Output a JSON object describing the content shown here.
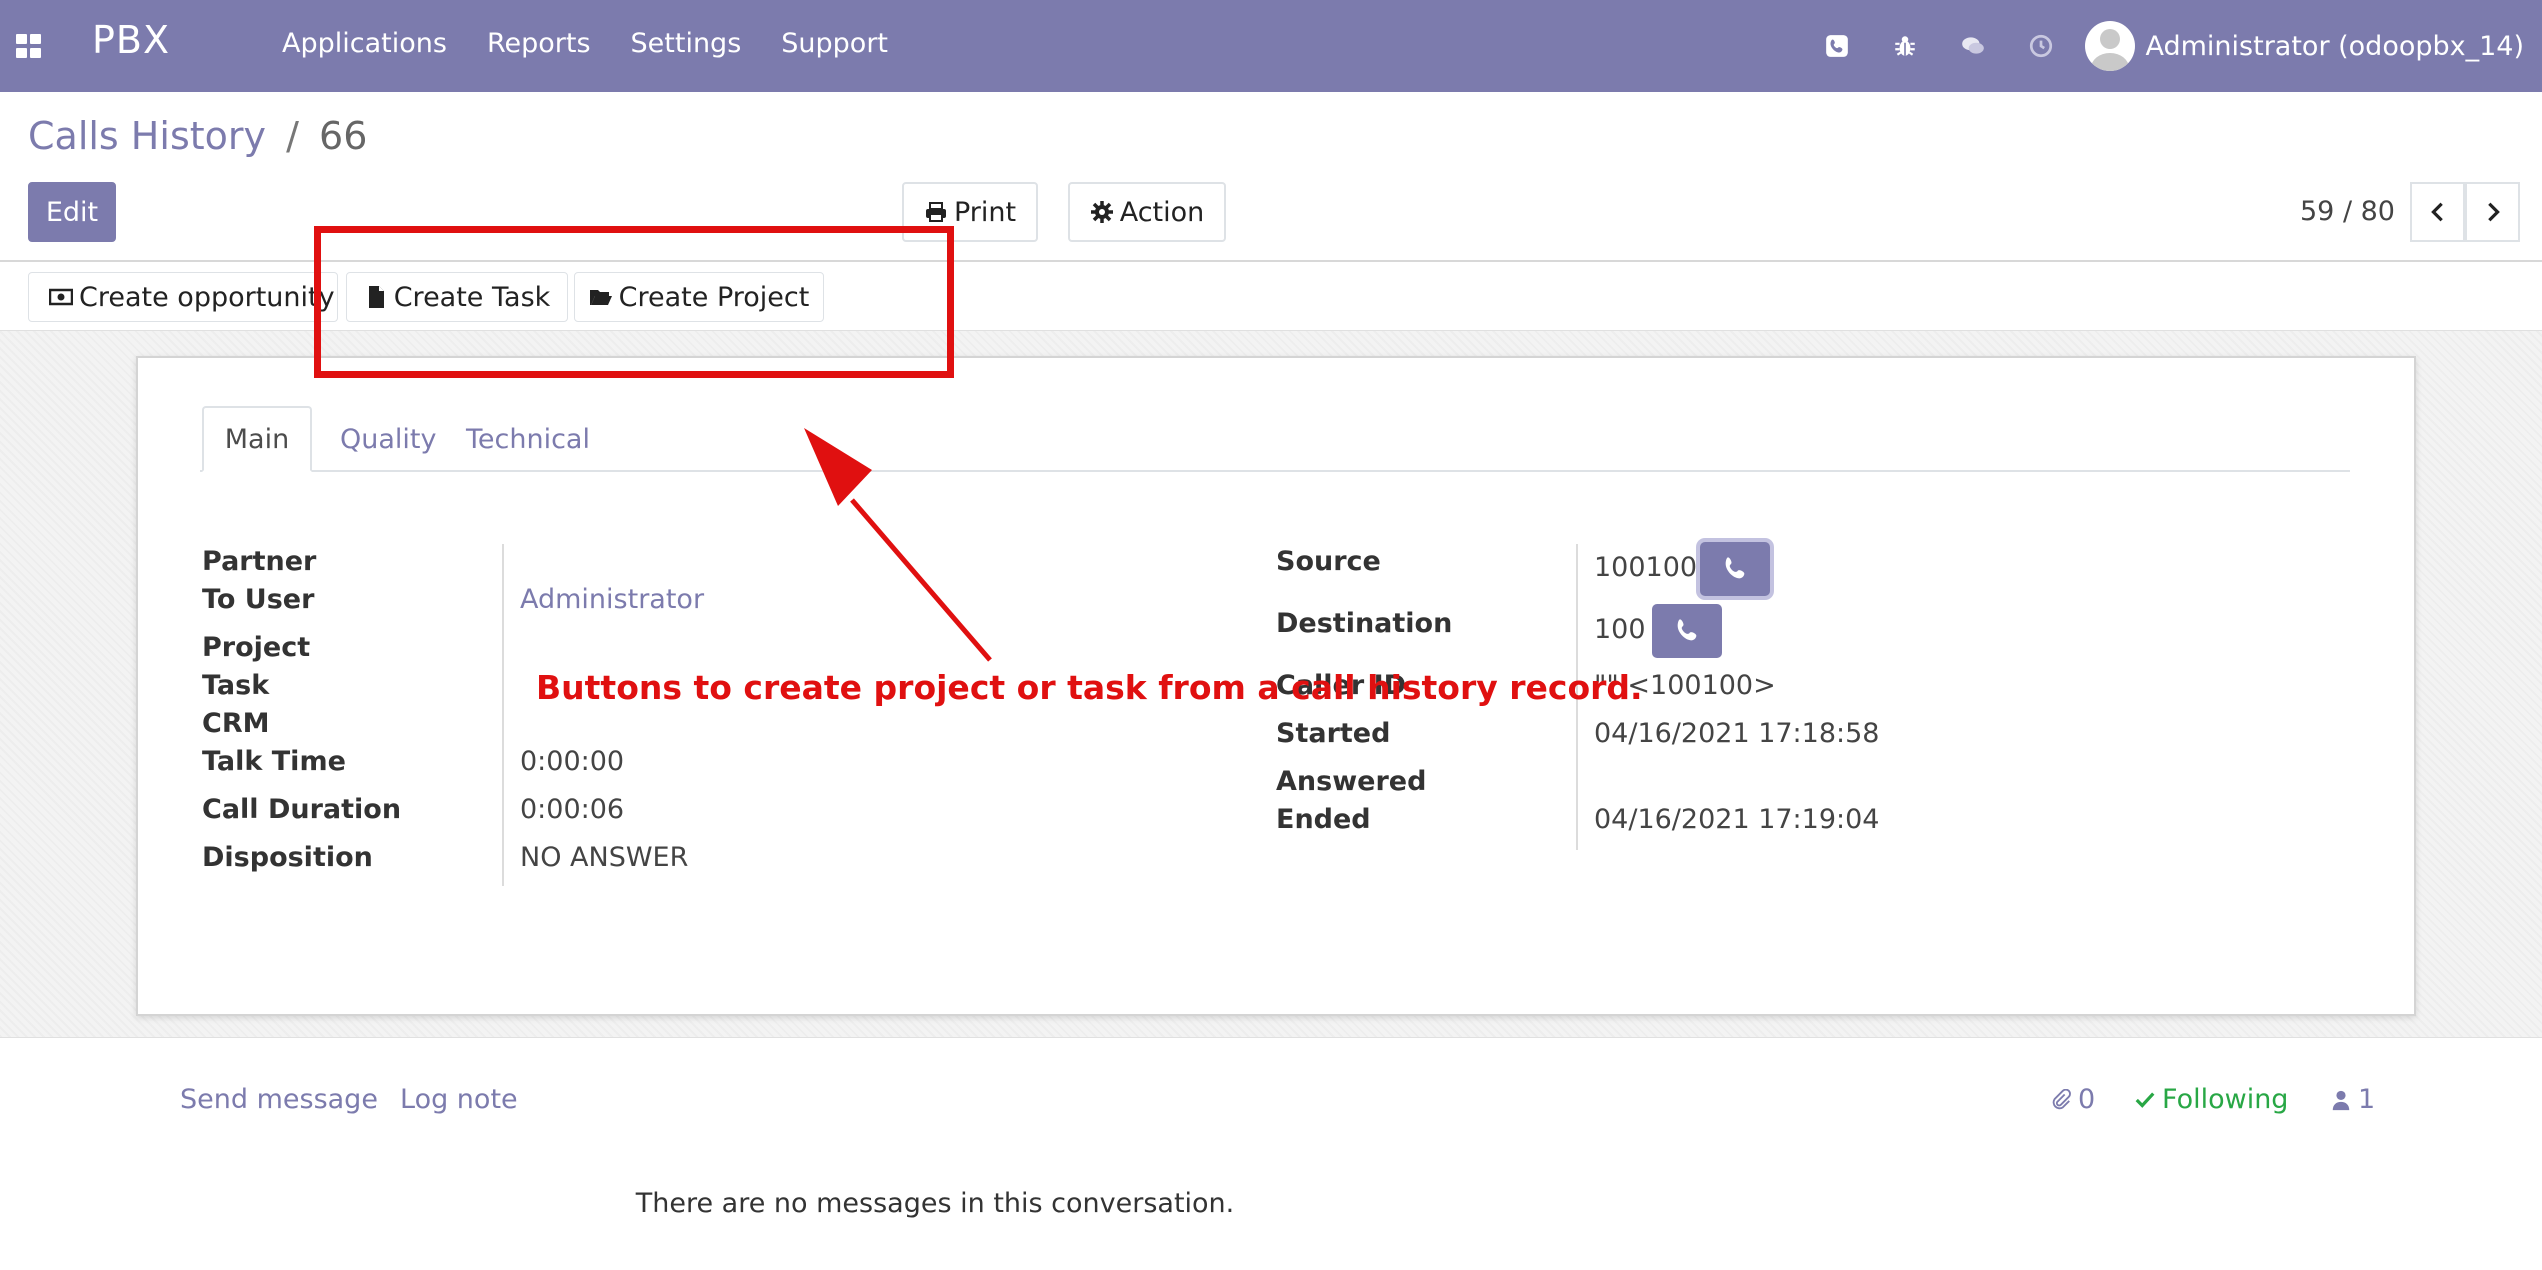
{
  "navbar": {
    "brand": "PBX",
    "menu": [
      "Applications",
      "Reports",
      "Settings",
      "Support"
    ],
    "user": "Administrator (odoopbx_14)",
    "colors": {
      "brand": "#7c7bad"
    },
    "icons": [
      "phone-icon",
      "bug-icon",
      "chat-icon",
      "clock-icon"
    ]
  },
  "breadcrumb": {
    "parent": "Calls History",
    "separator": "/",
    "current": "66"
  },
  "toolbar": {
    "edit": "Edit",
    "print": "Print",
    "action": "Action"
  },
  "pager": {
    "value": "59 / 80"
  },
  "button_box": {
    "create_opportunity": "Create opportunity",
    "create_task": "Create Task",
    "create_project": "Create Project"
  },
  "tabs": [
    "Main",
    "Quality",
    "Technical"
  ],
  "left_fields": {
    "partner": {
      "label": "Partner",
      "value": ""
    },
    "to_user": {
      "label": "To User",
      "value": "Administrator"
    },
    "project": {
      "label": "Project",
      "value": ""
    },
    "task": {
      "label": "Task",
      "value": ""
    },
    "crm": {
      "label": "CRM",
      "value": ""
    },
    "talk_time": {
      "label": "Talk Time",
      "value": "0:00:00"
    },
    "call_duration": {
      "label": "Call Duration",
      "value": "0:00:06"
    },
    "disposition": {
      "label": "Disposition",
      "value": "NO ANSWER"
    }
  },
  "right_fields": {
    "source": {
      "label": "Source",
      "value": "100100"
    },
    "destination": {
      "label": "Destination",
      "value": "100"
    },
    "caller_id": {
      "label": "Caller ID",
      "value": "\"\" <100100>"
    },
    "started": {
      "label": "Started",
      "value": "04/16/2021 17:18:58"
    },
    "answered": {
      "label": "Answered",
      "value": ""
    },
    "ended": {
      "label": "Ended",
      "value": "04/16/2021 17:19:04"
    }
  },
  "annotation": {
    "text": "Buttons to create project or task from a call history record.",
    "color": "#e01010"
  },
  "chatter": {
    "send_message": "Send message",
    "log_note": "Log note",
    "attachments": "0",
    "following": "Following",
    "followers": "1",
    "empty": "There are no messages in this conversation."
  }
}
